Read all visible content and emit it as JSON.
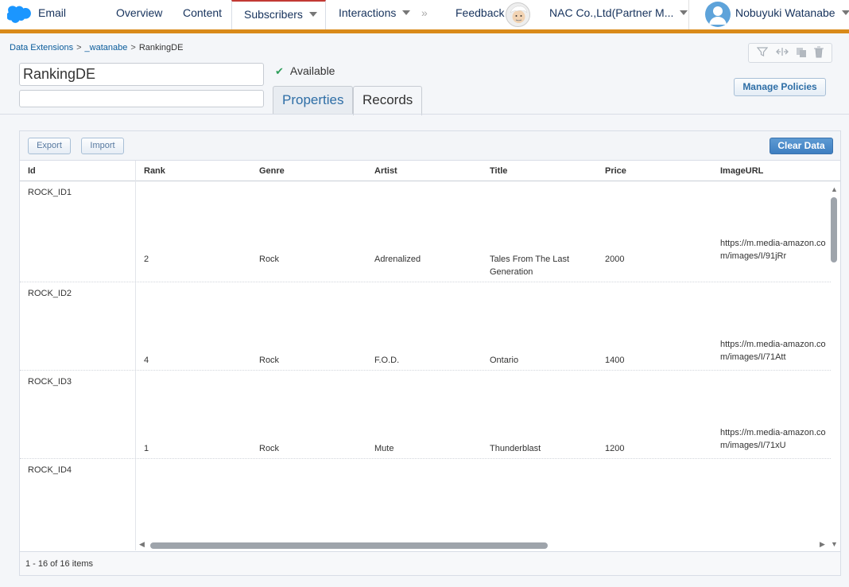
{
  "nav": {
    "app_name": "Email",
    "items": [
      "Overview",
      "Content",
      "Subscribers",
      "Interactions"
    ],
    "feedback": "Feedback",
    "company": "NAC Co.,Ltd(Partner M...",
    "user": "Nobuyuki Watanabe",
    "active_tab_color": "#c23934",
    "accent": "#d98a1a"
  },
  "breadcrumb": [
    "Data Extensions",
    "_watanabe",
    "RankingDE"
  ],
  "de": {
    "name": "RankingDE",
    "description": "",
    "status": "Available"
  },
  "tabs": [
    "Properties",
    "Records"
  ],
  "actions": {
    "manage_policies": "Manage Policies",
    "export": "Export",
    "import": "Import",
    "clear_data": "Clear Data"
  },
  "table": {
    "columns": [
      "Id",
      "Rank",
      "Genre",
      "Artist",
      "Title",
      "Price",
      "ImageURL"
    ],
    "rows": [
      {
        "id": "ROCK_ID1",
        "rank": "2",
        "genre": "Rock",
        "artist": "Adrenalized",
        "title": "Tales From The Last Generation",
        "price": "2000",
        "image_url": "https://m.media-amazon.com/images/I/91jRr"
      },
      {
        "id": "ROCK_ID2",
        "rank": "4",
        "genre": "Rock",
        "artist": "F.O.D.",
        "title": "Ontario",
        "price": "1400",
        "image_url": "https://m.media-amazon.com/images/I/71Att"
      },
      {
        "id": "ROCK_ID3",
        "rank": "1",
        "genre": "Rock",
        "artist": "Mute",
        "title": "Thunderblast",
        "price": "1200",
        "image_url": "https://m.media-amazon.com/images/I/71xU"
      },
      {
        "id": "ROCK_ID4",
        "rank": "",
        "genre": "",
        "artist": "",
        "title": "",
        "price": "",
        "image_url": ""
      }
    ]
  },
  "pagination": "1 - 16 of 16 items"
}
